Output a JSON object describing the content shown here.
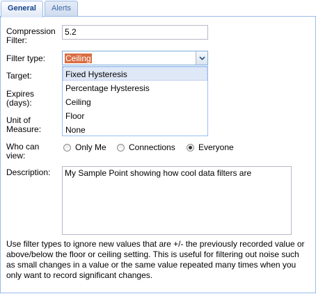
{
  "tabs": [
    {
      "label": "General",
      "active": true
    },
    {
      "label": "Alerts",
      "active": false
    }
  ],
  "form": {
    "compression": {
      "label": "Compression Filter:",
      "value": "5.2"
    },
    "filter_type": {
      "label": "Filter type:",
      "value": "Ceiling",
      "options": [
        "Fixed Hysteresis",
        "Percentage Hysteresis",
        "Ceiling",
        "Floor",
        "None"
      ],
      "highlighted": "Fixed Hysteresis"
    },
    "target": {
      "label": "Target:"
    },
    "expires": {
      "label": "Expires (days):"
    },
    "unit": {
      "label": "Unit of Measure:"
    },
    "who_can_view": {
      "label": "Who can view:",
      "options": [
        {
          "label": "Only Me",
          "checked": false
        },
        {
          "label": "Connections",
          "checked": false
        },
        {
          "label": "Everyone",
          "checked": true
        }
      ]
    },
    "description": {
      "label": "Description:",
      "value": "My Sample Point showing how cool data filters are"
    }
  },
  "help_text": "Use filter types to ignore new values that are +/- the previously recorded value or above/below the floor or ceiling setting. This is useful for filtering out noise such as small changes in a value or the same value repeated many times when you only want to record significant changes.",
  "colors": {
    "tab_active_text": "#15428b",
    "selection_bg": "#d96d42",
    "dropdown_highlight": "#dfe8f6",
    "border_blue": "#99bbe8"
  }
}
